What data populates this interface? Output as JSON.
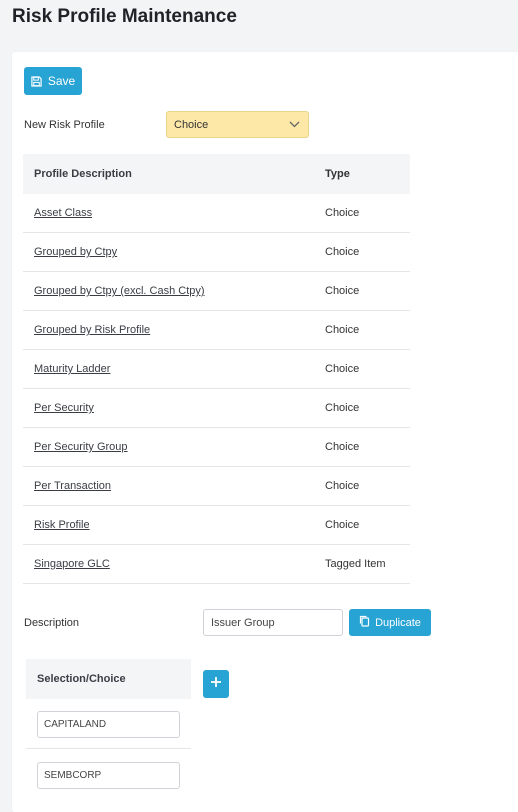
{
  "page": {
    "title": "Risk Profile Maintenance"
  },
  "toolbar": {
    "save_label": "Save",
    "save_icon": "floppy-disk-icon"
  },
  "new_profile": {
    "label": "New Risk Profile",
    "selected": "Choice",
    "dropdown_icon": "chevron-down-icon"
  },
  "profiles_table": {
    "headers": [
      "Profile Description",
      "Type"
    ],
    "rows": [
      {
        "description": "Asset Class",
        "type": "Choice"
      },
      {
        "description": "Grouped by Ctpy",
        "type": "Choice"
      },
      {
        "description": "Grouped by Ctpy (excl. Cash Ctpy)",
        "type": "Choice"
      },
      {
        "description": "Grouped by Risk Profile",
        "type": "Choice"
      },
      {
        "description": "Maturity Ladder",
        "type": "Choice"
      },
      {
        "description": "Per Security",
        "type": "Choice"
      },
      {
        "description": "Per Security Group",
        "type": "Choice"
      },
      {
        "description": "Per Transaction",
        "type": "Choice"
      },
      {
        "description": "Risk Profile",
        "type": "Choice"
      },
      {
        "description": "Singapore GLC",
        "type": "Tagged Item"
      }
    ]
  },
  "detail": {
    "description_label": "Description",
    "description_value": "Issuer Group",
    "duplicate_label": "Duplicate",
    "duplicate_icon": "copy-icon"
  },
  "selection": {
    "header": "Selection/Choice",
    "add_icon": "plus-icon",
    "items": [
      "CAPITALAND",
      "SEMBCORP"
    ]
  },
  "colors": {
    "accent": "#27a3d4",
    "select_highlight": "#fde8a8",
    "page_background": "#f2f4f6"
  }
}
